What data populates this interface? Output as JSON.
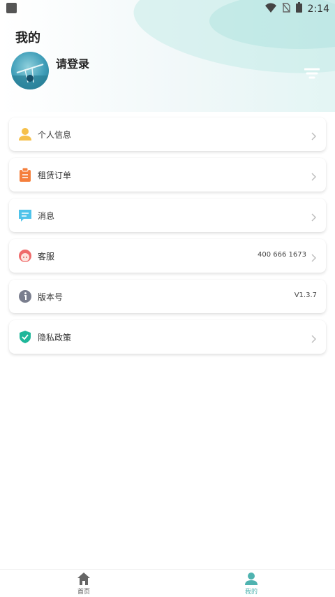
{
  "status_bar": {
    "time": "2:14"
  },
  "header": {
    "title": "我的",
    "login_label": "请登录"
  },
  "menu": [
    {
      "label": "个人信息",
      "icon": "person-icon",
      "color": "#f6c04a",
      "value": "",
      "chevron": true
    },
    {
      "label": "租赁订单",
      "icon": "clipboard-icon",
      "color": "#f57f3c",
      "value": "",
      "chevron": true
    },
    {
      "label": "消息",
      "icon": "message-icon",
      "color": "#4fc3ea",
      "value": "",
      "chevron": true
    },
    {
      "label": "客服",
      "icon": "customer-service-icon",
      "color": "#ef6a6a",
      "value": "400 666 1673",
      "chevron": true
    },
    {
      "label": "版本号",
      "icon": "info-icon",
      "color": "#7a7e8e",
      "value": "V1.3.7",
      "chevron": false
    },
    {
      "label": "隐私政策",
      "icon": "shield-check-icon",
      "color": "#1fb79a",
      "value": "",
      "chevron": true
    }
  ],
  "bottom_nav": {
    "home_label": "首页",
    "mine_label": "我的",
    "active": "mine",
    "active_color": "#4fb3b0"
  }
}
